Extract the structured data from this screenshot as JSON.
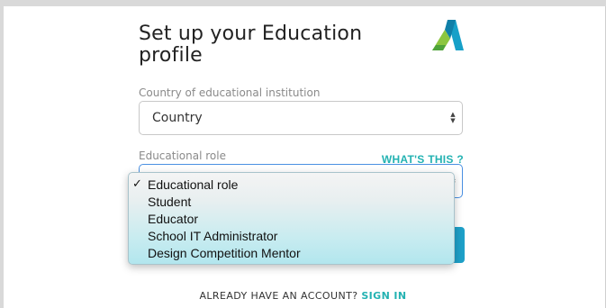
{
  "page": {
    "title": "Set up your Education profile"
  },
  "form": {
    "country_label": "Country of educational institution",
    "country_value": "Country",
    "role_label": "Educational role",
    "whats_this": "WHAT'S THIS ?"
  },
  "dropdown": {
    "options": [
      {
        "label": "Educational role",
        "selected": true
      },
      {
        "label": "Student",
        "selected": false
      },
      {
        "label": "Educator",
        "selected": false
      },
      {
        "label": "School IT Administrator",
        "selected": false
      },
      {
        "label": "Design Competition Mentor",
        "selected": false
      }
    ],
    "check_mark": "✓"
  },
  "footer": {
    "prompt": "ALREADY HAVE AN ACCOUNT?",
    "link": "SIGN IN"
  },
  "colors": {
    "accent": "#23b2b2",
    "button": "#1ea0c8"
  },
  "icons": {
    "logo": "autodesk-logo-icon",
    "select_arrows": "updown-arrows-icon"
  }
}
